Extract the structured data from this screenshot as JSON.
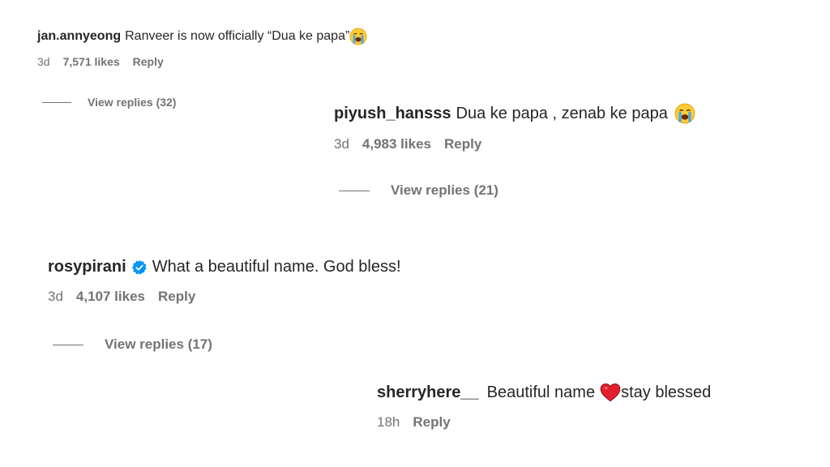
{
  "comments": [
    {
      "username": "jan.annyeong",
      "text": "Ranveer is now officially “Dua ke papa”",
      "emoji": "loudly-crying-face-icon",
      "time": "3d",
      "likes": "7,571 likes",
      "reply_label": "Reply",
      "view_replies": "View replies (32)"
    },
    {
      "username": "piyush_hansss",
      "text": "Dua ke papa , zenab ke papa",
      "emoji": "loudly-crying-face-icon",
      "time": "3d",
      "likes": "4,983 likes",
      "reply_label": "Reply",
      "view_replies": "View replies (21)"
    },
    {
      "username": "rosypirani",
      "verified": true,
      "text": "What a beautiful name. God bless!",
      "time": "3d",
      "likes": "4,107 likes",
      "reply_label": "Reply",
      "view_replies": "View replies (17)"
    },
    {
      "username": "sherryhere__",
      "text_before": "Beautiful name",
      "emoji": "red-heart-icon",
      "text_after": "stay blessed",
      "time": "18h",
      "reply_label": "Reply"
    }
  ],
  "colors": {
    "primary_text": "#262626",
    "secondary_text": "#737373",
    "verified_blue": "#0095f6",
    "heart_red": "#e0202e",
    "emoji_yellow": "#ffcc33"
  }
}
